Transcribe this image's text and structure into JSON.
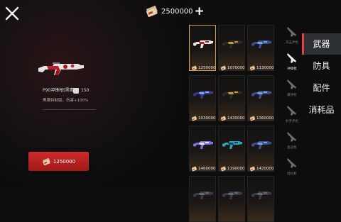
{
  "header": {
    "currency_icon": "cash-stack-icon",
    "currency_amount": "2500000",
    "add_label": "+"
  },
  "selected_item": {
    "name": "P90冲锋枪[黑鹰]",
    "weight": "150",
    "description": "黑鹰特制版。伤害+100%",
    "buy_price": "1250000"
  },
  "grid": {
    "columns": 3,
    "items": [
      {
        "price": "1250000",
        "icon": "smg-red-white-icon",
        "selected": true
      },
      {
        "price": "1070000",
        "icon": "smg-gold-icon",
        "selected": false
      },
      {
        "price": "1130000",
        "icon": "smg-blue-icon",
        "selected": false
      },
      {
        "price": "1030000",
        "icon": "rifle-blue-icon",
        "selected": false
      },
      {
        "price": "1430000",
        "icon": "smg-gold-icon",
        "selected": false
      },
      {
        "price": "1360000",
        "icon": "smg-blue-icon",
        "selected": false
      },
      {
        "price": "1460000",
        "icon": "rifle-purple-icon",
        "selected": false
      },
      {
        "price": "1190000",
        "icon": "smg-cyan-icon",
        "selected": false
      },
      {
        "price": "1420000",
        "icon": "smg-blue-icon",
        "selected": false
      },
      {
        "price": "",
        "icon": "weapon-icon",
        "selected": false
      },
      {
        "price": "",
        "icon": "weapon-icon",
        "selected": false
      },
      {
        "price": "",
        "icon": "weapon-icon",
        "selected": false
      }
    ]
  },
  "subcategories": [
    {
      "label": "突击步枪",
      "icon": "assault-rifle-icon",
      "active": false
    },
    {
      "label": "冲锋枪",
      "icon": "smg-icon",
      "active": true
    },
    {
      "label": "霰弹枪",
      "icon": "shotgun-icon",
      "active": false
    },
    {
      "label": "射手步枪",
      "icon": "marksman-rifle-icon",
      "active": false
    },
    {
      "label": "狙击枪",
      "icon": "sniper-rifle-icon",
      "active": false
    },
    {
      "label": "轻机枪",
      "icon": "lmg-icon",
      "active": false
    }
  ],
  "tabs": [
    {
      "label": "武器",
      "active": true
    },
    {
      "label": "防具",
      "active": false
    },
    {
      "label": "配件",
      "active": false
    },
    {
      "label": "消耗品",
      "active": false
    }
  ],
  "colors": {
    "accent": "#d6a23c",
    "buy_button": "#b82020",
    "tab_active_bg": "#2d3034"
  }
}
